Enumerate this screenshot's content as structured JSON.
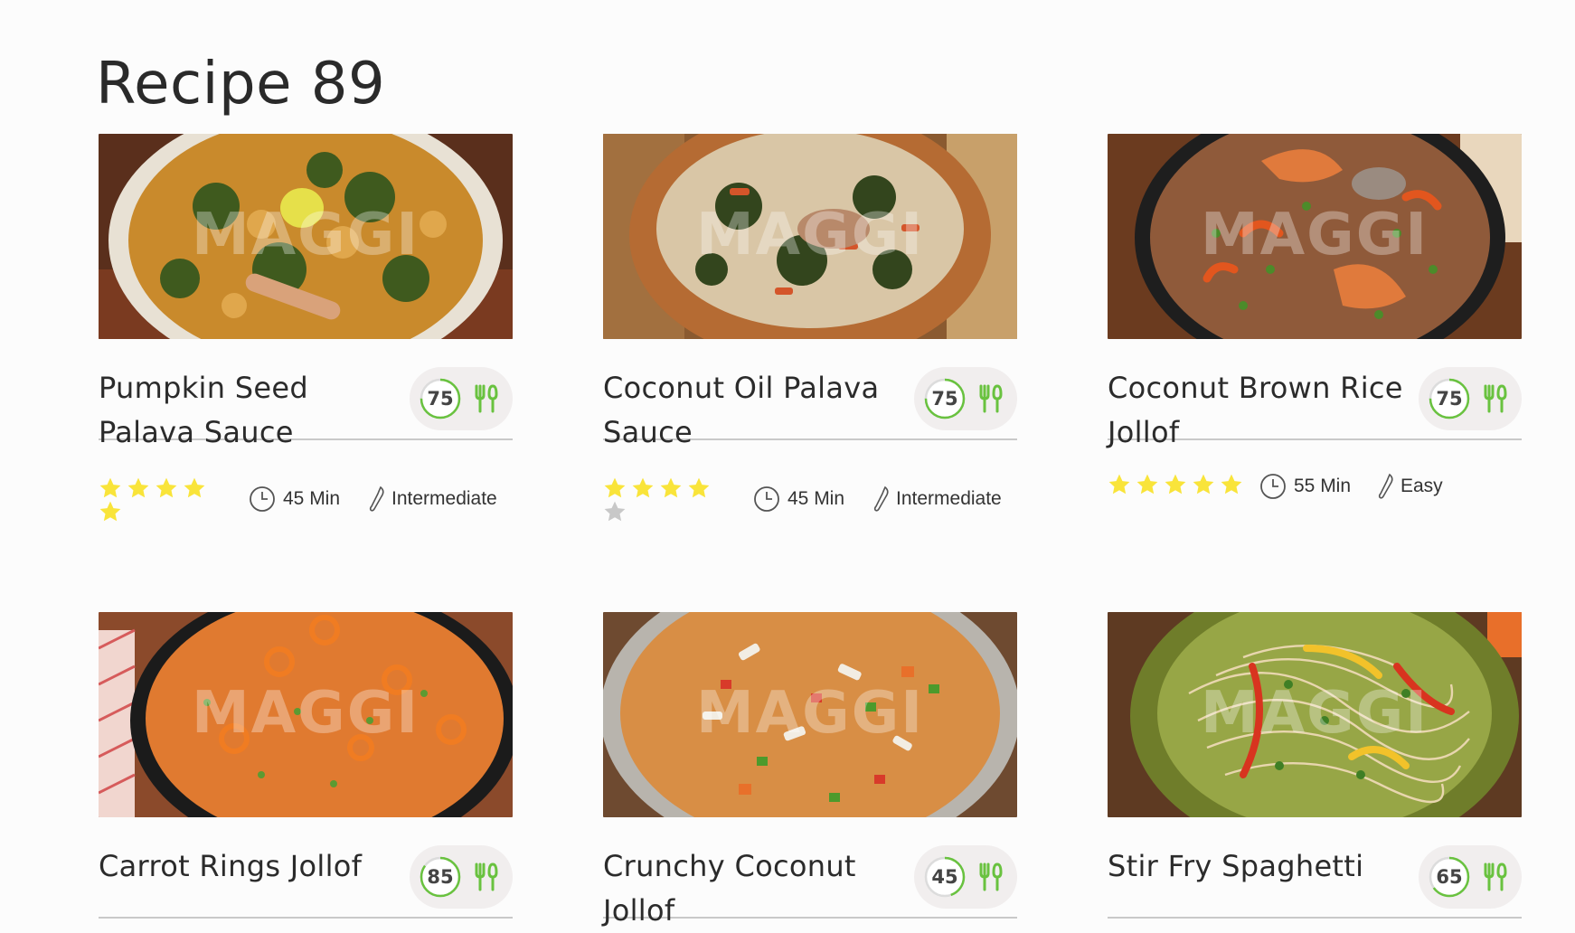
{
  "page": {
    "title": "Recipe 89"
  },
  "brand": {
    "watermark": "MAGGI"
  },
  "colors": {
    "star_on": "#f9e43a",
    "star_off": "#c8c8c8",
    "score_green": "#69c23f",
    "divider": "#c9c9c9"
  },
  "recipes": [
    {
      "title": "Pumpkin Seed Palava Sauce",
      "score": "75",
      "score_fraction": 0.75,
      "rating": 5,
      "time": "45 Min",
      "difficulty": "Intermediate",
      "icon": "palava-sauce-dish"
    },
    {
      "title": "Coconut Oil Palava Sauce",
      "score": "75",
      "score_fraction": 0.75,
      "rating": 4,
      "time": "45 Min",
      "difficulty": "Intermediate",
      "icon": "palava-sauce-bowl"
    },
    {
      "title": "Coconut Brown Rice Jollof",
      "score": "75",
      "score_fraction": 0.75,
      "rating": 5,
      "time": "55 Min",
      "difficulty": "Easy",
      "icon": "jollof-prawn-pan"
    },
    {
      "title": "Carrot Rings Jollof",
      "score": "85",
      "score_fraction": 0.85,
      "icon": "carrot-jollof-pan"
    },
    {
      "title": "Crunchy Coconut Jollof",
      "score": "45",
      "score_fraction": 0.45,
      "icon": "coconut-jollof-dish"
    },
    {
      "title": "Stir Fry Spaghetti",
      "score": "65",
      "score_fraction": 0.65,
      "icon": "spaghetti-bowl"
    }
  ]
}
